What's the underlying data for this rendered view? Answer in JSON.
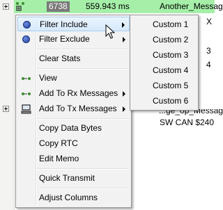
{
  "grid": {
    "row1": {
      "id": "6738",
      "time": "559.943 ms",
      "name_fragment": "Another_Messag"
    },
    "right_fragments": [
      "X",
      "3",
      "4"
    ],
    "row_message_fragment": "...ge_op_Message",
    "row_last": "SW CAN $240"
  },
  "context_menu": {
    "items": [
      {
        "label": "Filter Include",
        "icon": "filter-include-circle-icon",
        "has_submenu": true,
        "highlighted": true
      },
      {
        "label": "Filter Exclude",
        "icon": "filter-exclude-circle-icon",
        "has_submenu": true
      },
      {
        "label": "Clear Stats"
      },
      {
        "label": "View",
        "icon": "signal-view-icon"
      },
      {
        "label": "Add To Rx Messages",
        "icon": "signal-rx-icon",
        "has_submenu": true
      },
      {
        "label": "Add To Tx Messages",
        "icon": "computer-tx-icon",
        "has_submenu": true
      },
      {
        "label": "Copy Data Bytes"
      },
      {
        "label": "Copy RTC"
      },
      {
        "label": "Edit Memo"
      },
      {
        "label": "Quick Transmit"
      },
      {
        "label": "Adjust Columns"
      }
    ]
  },
  "submenu": {
    "items": [
      "Custom 1",
      "Custom 2",
      "Custom 3",
      "Custom 4",
      "Custom 5",
      "Custom 6"
    ]
  },
  "colors": {
    "row_highlight": "#a5efa8",
    "menu_background": "#f2f2f2",
    "menu_highlight": "#d6e9fb",
    "filter_circle": "#1f3f9f"
  }
}
